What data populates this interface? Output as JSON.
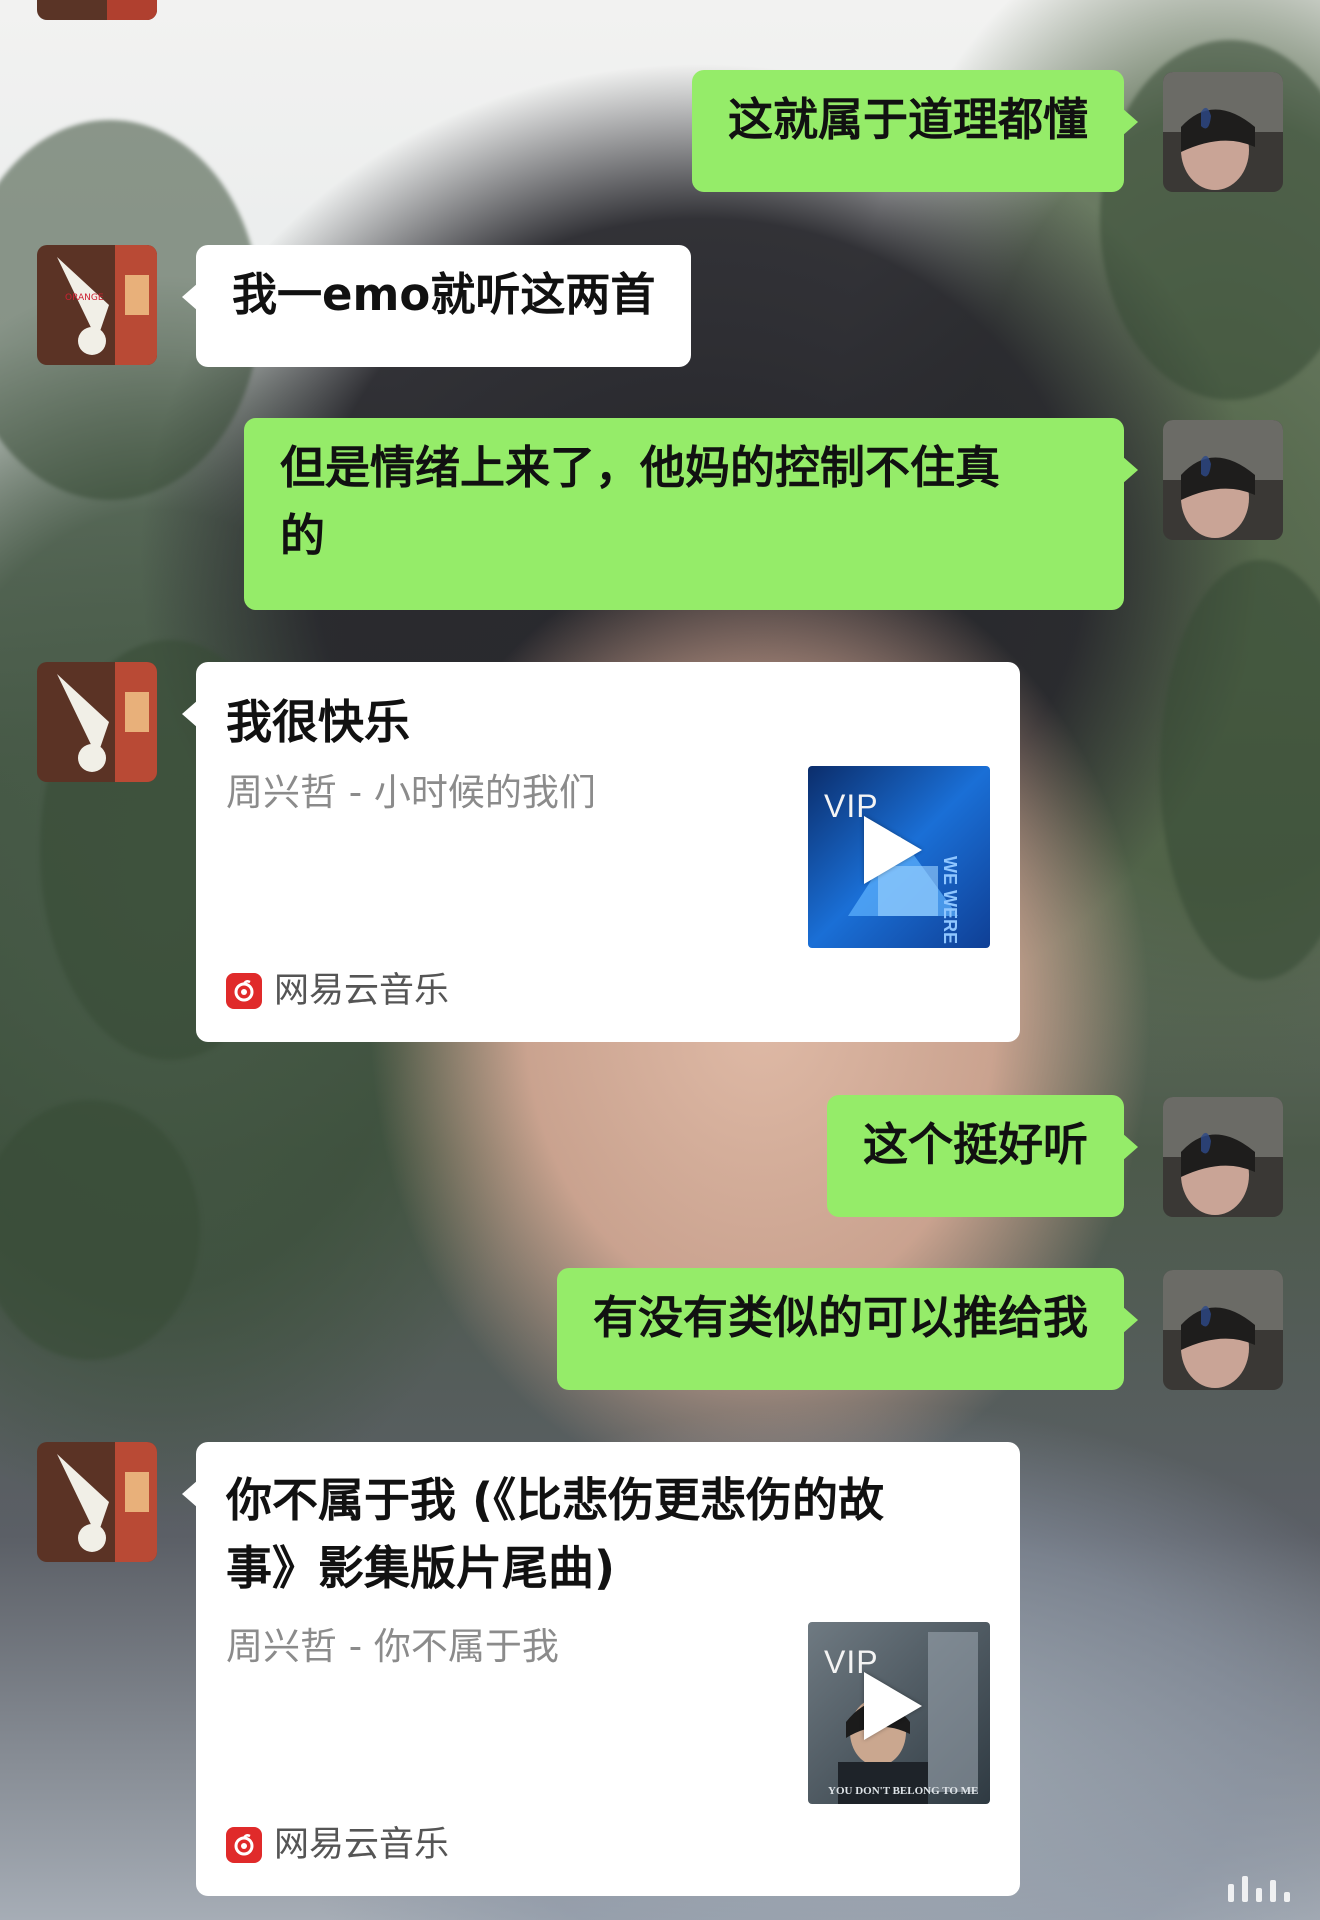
{
  "messages": [
    {
      "side": "right",
      "text": "这就属于道理都懂"
    },
    {
      "side": "left",
      "text": "我一emo就听这两首"
    },
    {
      "side": "right",
      "text_line1": "但是情绪上来了，他妈的控制不住真",
      "text_line2": "的"
    },
    {
      "side": "left",
      "type": "music_card",
      "title": "我很快乐",
      "subtitle": "周兴哲 - 小时候的我们",
      "badge": "VIP",
      "cover_text": "WE WERE YOUNG",
      "source": "网易云音乐"
    },
    {
      "side": "right",
      "text": "这个挺好听"
    },
    {
      "side": "right",
      "text": "有没有类似的可以推给我"
    },
    {
      "side": "left",
      "type": "music_card",
      "title_line1": "你不属于我 (《比悲伤更悲伤的故",
      "title_line2": "事》影集版片尾曲)",
      "subtitle": "周兴哲 - 你不属于我",
      "badge": "VIP",
      "cover_text": "YOU DON'T BELONG TO ME",
      "source": "网易云音乐"
    }
  ],
  "colors": {
    "sent_bubble": "#95ec69",
    "received_bubble": "#ffffff",
    "netease_red": "#e02a2a"
  }
}
